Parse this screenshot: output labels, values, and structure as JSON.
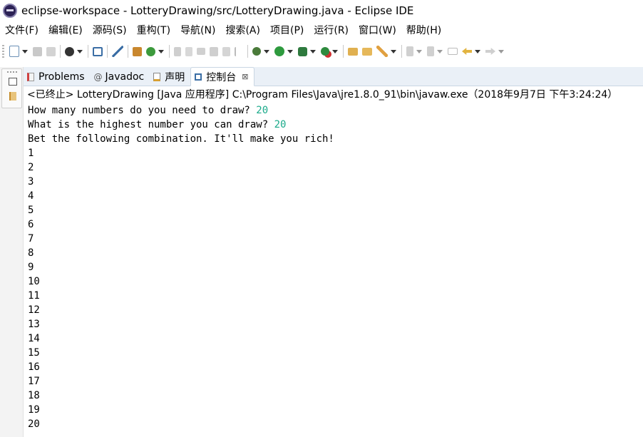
{
  "window": {
    "title": "eclipse-workspace - LotteryDrawing/src/LotteryDrawing.java - Eclipse IDE",
    "app_icon": "eclipse-icon"
  },
  "menu": [
    "文件(F)",
    "编辑(E)",
    "源码(S)",
    "重构(T)",
    "导航(N)",
    "搜索(A)",
    "项目(P)",
    "运行(R)",
    "窗口(W)",
    "帮助(H)"
  ],
  "tabs": [
    {
      "label": "Problems",
      "icon": "problems-icon",
      "active": false
    },
    {
      "label": "Javadoc",
      "icon": "javadoc-icon",
      "active": false
    },
    {
      "label": "声明",
      "icon": "declaration-icon",
      "active": false
    },
    {
      "label": "控制台",
      "icon": "console-icon",
      "active": true,
      "close": "⊠"
    }
  ],
  "console": {
    "header": "<已终止> LotteryDrawing [Java 应用程序] C:\\Program Files\\Java\\jre1.8.0_91\\bin\\javaw.exe（2018年9月7日 下午3:24:24）",
    "prompt1": "How many numbers do you need to draw? ",
    "input1": "20",
    "prompt2": "What is the highest number you can draw? ",
    "input2": "20",
    "result_line": "Bet the following combination. It'll make you rich!",
    "numbers": [
      "1",
      "2",
      "3",
      "4",
      "5",
      "6",
      "7",
      "8",
      "9",
      "10",
      "11",
      "12",
      "13",
      "14",
      "15",
      "16",
      "17",
      "18",
      "19",
      "20"
    ]
  },
  "colors": {
    "input_text": "#1aaa8a",
    "tab_bar_bg": "#eaf0f7"
  }
}
